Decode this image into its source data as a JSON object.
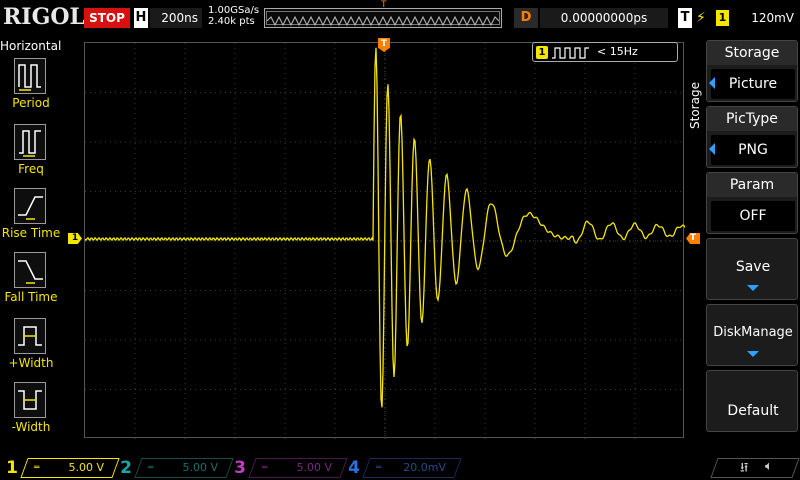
{
  "topbar": {
    "logo": "RIGOL",
    "run_state": "STOP",
    "horizontal_badge": "H",
    "timebase": "200ns",
    "sample_rate": "1.00GSa/s",
    "memory_depth": "2.40k pts",
    "trigger_marker": "T",
    "delay_badge": "D",
    "delay_value": "0.00000000ps",
    "trigger_badge": "T",
    "trigger_slope": "⚡",
    "trigger_channel": "1",
    "trigger_level": "120mV"
  },
  "left_panel": {
    "title": "Horizontal",
    "items": [
      {
        "label": "Period",
        "icon": "period-icon"
      },
      {
        "label": "Freq",
        "icon": "freq-icon"
      },
      {
        "label": "Rise Time",
        "icon": "rise-time-icon"
      },
      {
        "label": "Fall Time",
        "icon": "fall-time-icon"
      },
      {
        "label": "+Width",
        "icon": "positive-width-icon"
      },
      {
        "label": "-Width",
        "icon": "negative-width-icon"
      }
    ]
  },
  "screen": {
    "ch1_marker": "1",
    "trigger_pos_marker": "T",
    "trigger_level_marker": "T",
    "freq_channel": "1",
    "freq_readout": "< 15Hz",
    "trace_color": "#f5e600"
  },
  "right_panel": {
    "side_label": "Storage",
    "items": [
      {
        "title": "Storage",
        "value": "Picture"
      },
      {
        "title": "PicType",
        "value": "PNG"
      },
      {
        "title": "Param",
        "value": "OFF"
      }
    ],
    "buttons": [
      {
        "label": "Save"
      },
      {
        "label": "DiskManage"
      },
      {
        "label": "Default"
      }
    ]
  },
  "bottom_bar": {
    "channels": [
      {
        "num": "1",
        "scale": "5.00 V",
        "color": "#f5e600",
        "active": true
      },
      {
        "num": "2",
        "scale": "5.00 V",
        "color": "#18a8a8",
        "active": false
      },
      {
        "num": "3",
        "scale": "5.00 V",
        "color": "#c03cc0",
        "active": false
      },
      {
        "num": "4",
        "scale": "20.0mV",
        "color": "#2e6fd8",
        "active": false
      }
    ]
  }
}
